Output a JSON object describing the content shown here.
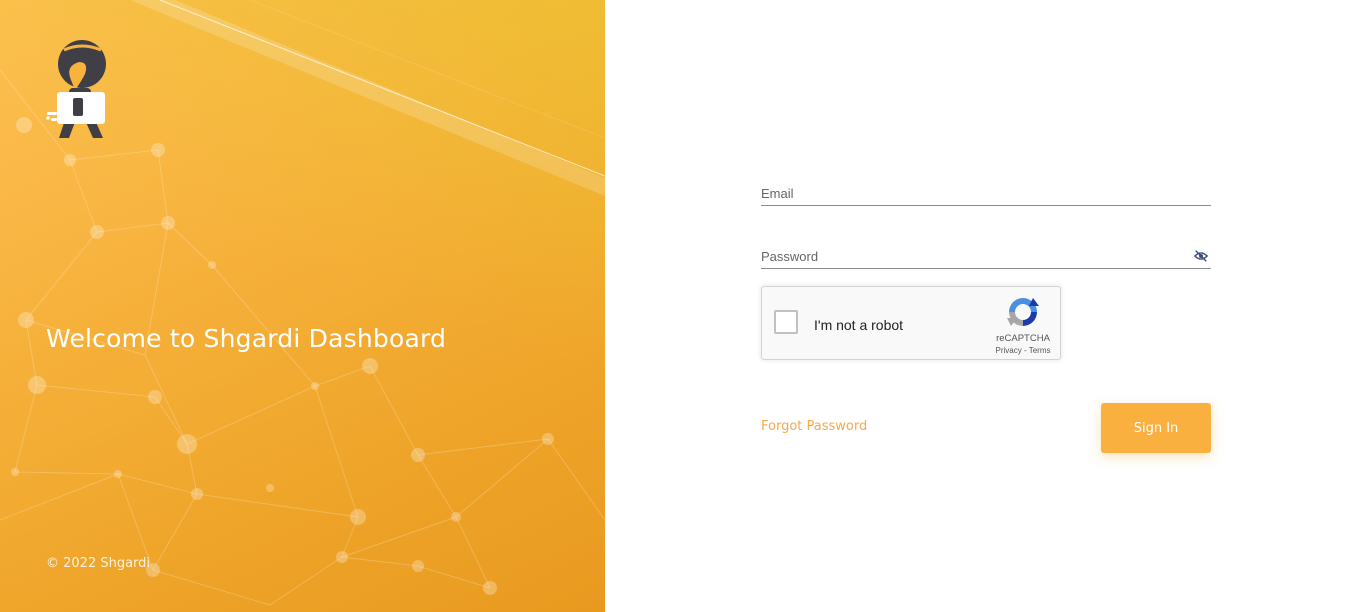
{
  "brand": {
    "welcome_text": "Welcome to Shgardi Dashboard",
    "copyright": "© 2022 Shgardi",
    "logo_icon": "shgardi-courier-logo",
    "gradient_colors": [
      "#ffbf55",
      "#e89a1f"
    ]
  },
  "login": {
    "email_placeholder": "Email",
    "password_placeholder": "Password",
    "password_toggle_icon": "eye-off-icon",
    "forgot_password_label": "Forgot Password",
    "sign_in_label": "Sign In",
    "accent_color": "#f9b03f"
  },
  "recaptcha": {
    "label": "I'm not a robot",
    "brand": "reCAPTCHA",
    "privacy_label": "Privacy",
    "separator": " - ",
    "terms_label": "Terms",
    "checked": false
  }
}
